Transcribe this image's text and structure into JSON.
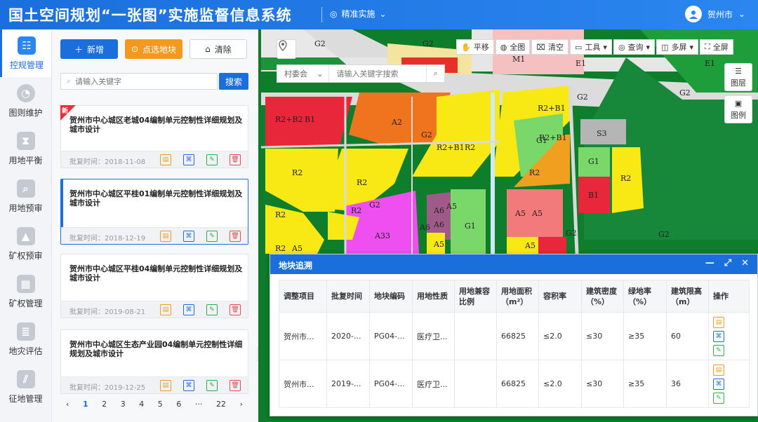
{
  "header": {
    "title": "国土空间规划“一张图”实施监督信息系统",
    "mode_label": "精准实施",
    "user_name": "贺州市"
  },
  "nav": {
    "items": [
      {
        "label": "控规管理",
        "icon": "plan-icon",
        "active": true
      },
      {
        "label": "图则维护",
        "icon": "pie-icon",
        "active": false
      },
      {
        "label": "用地平衡",
        "icon": "hourglass-icon",
        "active": false
      },
      {
        "label": "用地预审",
        "icon": "doc-search-icon",
        "active": false
      },
      {
        "label": "矿权预审",
        "icon": "mine-icon",
        "active": false
      },
      {
        "label": "矿权管理",
        "icon": "building-icon",
        "active": false
      },
      {
        "label": "地灾评估",
        "icon": "report-icon",
        "active": false
      },
      {
        "label": "征地管理",
        "icon": "field-icon",
        "active": false
      }
    ]
  },
  "list": {
    "add_label": "新增",
    "pick_label": "点选地块",
    "clear_label": "清除",
    "search_placeholder": "请输入关键字",
    "search_button": "搜索",
    "new_tag": "新",
    "date_prefix": "批复时间：",
    "cards": [
      {
        "title": "贺州市中心城区老城04编制单元控制性详细规划及城市设计",
        "date": "2018-11-08"
      },
      {
        "title": "贺州市中心城区平桂01编制单元控制性详细规划及城市设计",
        "date": "2018-12-19"
      },
      {
        "title": "贺州市中心城区平桂04编制单元控制性详细规划及城市设计",
        "date": "2019-08-21"
      },
      {
        "title": "贺州市中心城区生态产业园04编制单元控制性详细规划及城市设计",
        "date": "2019-12-25"
      }
    ],
    "pager": {
      "prev": "‹",
      "pages": [
        "1",
        "2",
        "3",
        "4",
        "5",
        "6",
        "···",
        "22"
      ],
      "current": "1",
      "next": "›"
    }
  },
  "map": {
    "tools": [
      "平移",
      "全图",
      "清空",
      "工具",
      "查询",
      "多屏",
      "全屏"
    ],
    "village_select": "村委会",
    "search_placeholder": "请输入关键字搜索",
    "layer_label": "图层",
    "legend_label": "图例",
    "labels": [
      "G2",
      "G2",
      "M1",
      "E1",
      "E1",
      "G2",
      "G2",
      "G2",
      "R2+B1",
      "B1",
      "A2",
      "G2",
      "R2+B1",
      "R2",
      "G1",
      "R2+B1",
      "G1",
      "S3",
      "G1",
      "R2",
      "R2",
      "R2",
      "B1",
      "R2",
      "R2",
      "A5",
      "A5",
      "A6",
      "A6",
      "A5",
      "G1",
      "A5",
      "A5",
      "A33",
      "R2",
      "R2",
      "A6",
      "A5",
      "G2",
      "G2"
    ]
  },
  "trace": {
    "title": "地块追溯",
    "columns": [
      "调整项目",
      "批复时间",
      "地块编码",
      "用地性质",
      "用地兼容比例",
      "用地面积（m²）",
      "容积率",
      "建筑密度（%）",
      "绿地率（%）",
      "建筑限高（m）",
      "操作"
    ],
    "rows": [
      [
        "贺州市...",
        "2020-...",
        "PG04-...",
        "医疗卫...",
        "",
        "66825",
        "≤2.0",
        "≤30",
        "≥35",
        "60"
      ],
      [
        "贺州市...",
        "2019-...",
        "PG04-...",
        "医疗卫...",
        "",
        "66825",
        "≤2.0",
        "≤30",
        "≥35",
        "36"
      ]
    ]
  }
}
